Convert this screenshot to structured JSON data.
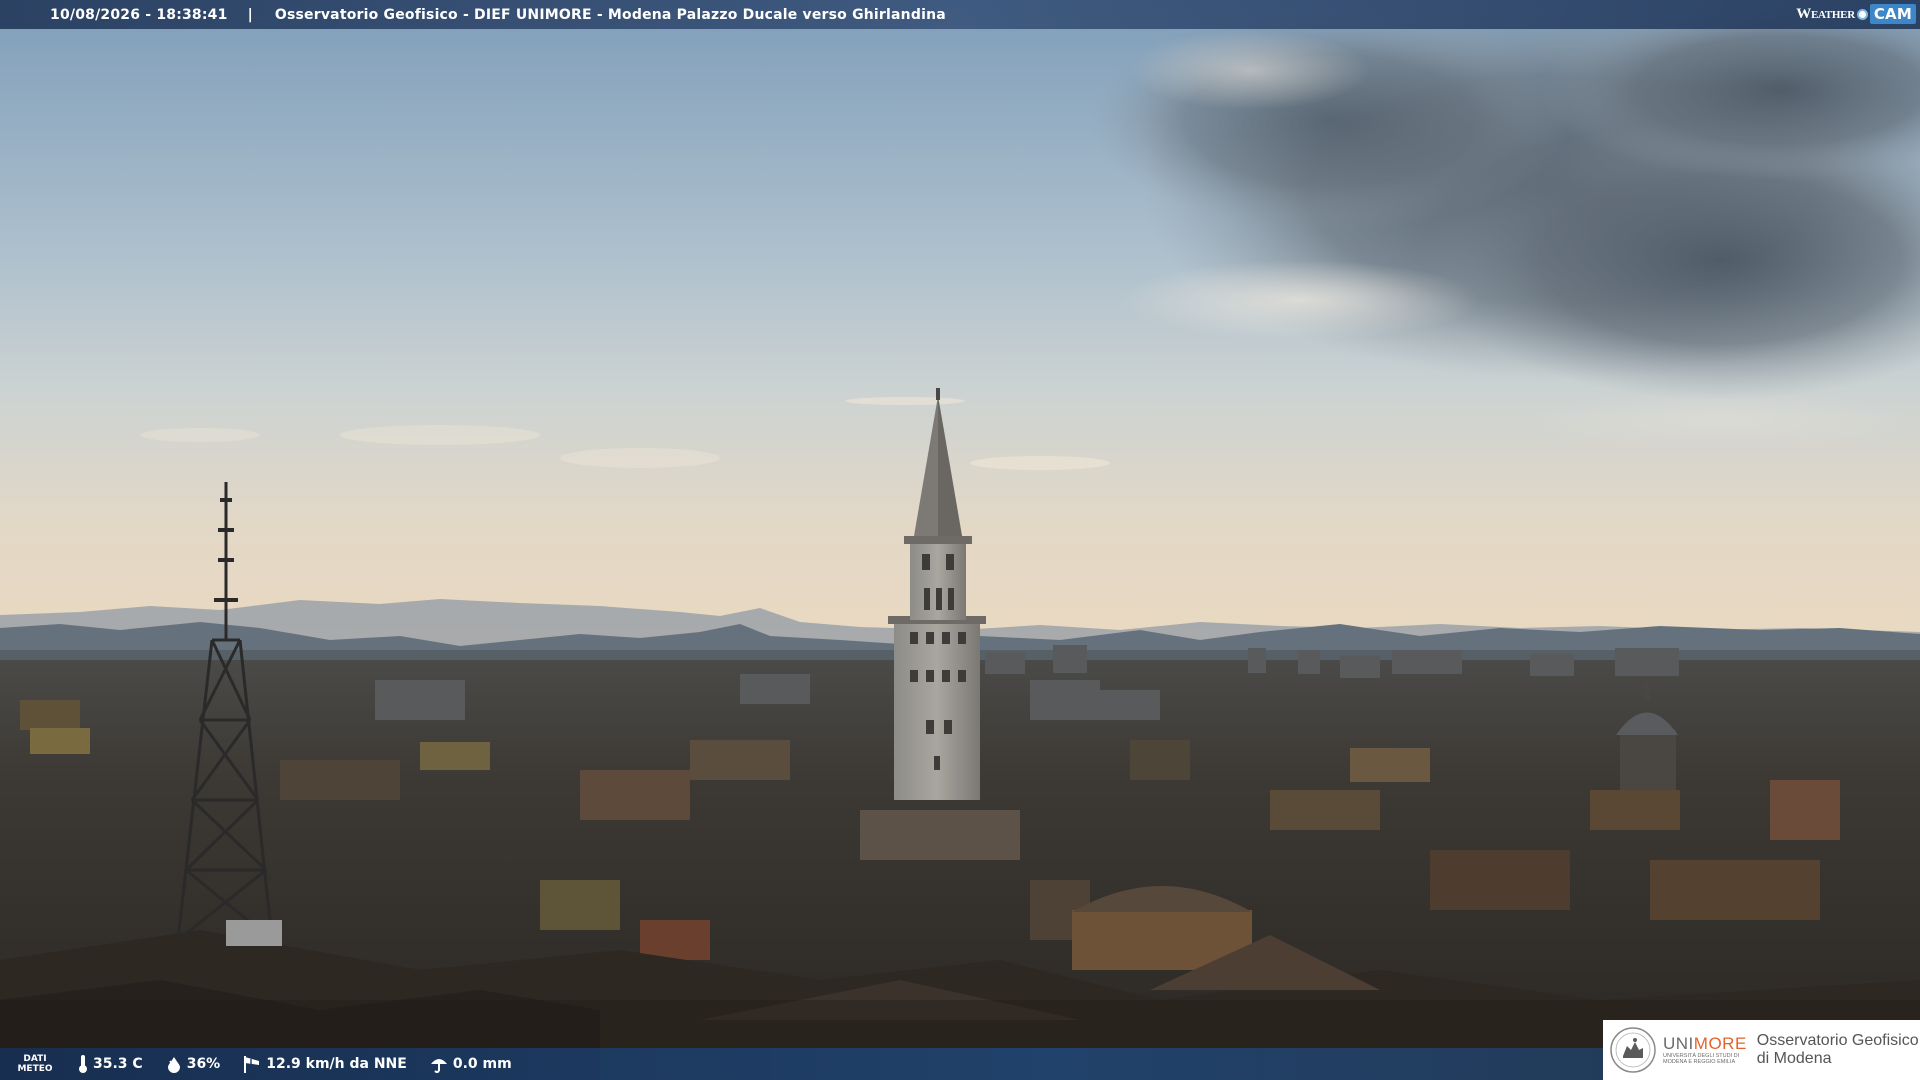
{
  "top_bar": {
    "datetime": "10/08/2026 - 18:38:41",
    "separator": "|",
    "title": "Osservatorio Geofisico - DIEF UNIMORE - Modena Palazzo Ducale verso Ghirlandina"
  },
  "branding": {
    "weathercam_weather": "Weather",
    "weathercam_cam": "CAM",
    "unimore_uni": "UNI",
    "unimore_more": "MORE",
    "unimore_subtitle": "UNIVERSITÀ DEGLI STUDI DI MODENA E REGGIO EMILIA",
    "observatory_line1": "Osservatorio Geofisico",
    "observatory_line2": "di Modena"
  },
  "weather_data": {
    "label_line1": "DATI",
    "label_line2": "METEO",
    "temperature": "35.3 C",
    "humidity": "36%",
    "wind": "12.9 km/h da NNE",
    "rain": "0.0 mm"
  },
  "icons": {
    "thermometer": "thermometer-icon",
    "humidity": "water-drop-icon",
    "wind": "windsock-icon",
    "rain": "umbrella-icon"
  },
  "colors": {
    "bar_blue": "#243a5c",
    "cam_blue": "#3d86c8",
    "unimore_orange": "#e4632b",
    "unimore_grey": "#6b6b6b"
  }
}
